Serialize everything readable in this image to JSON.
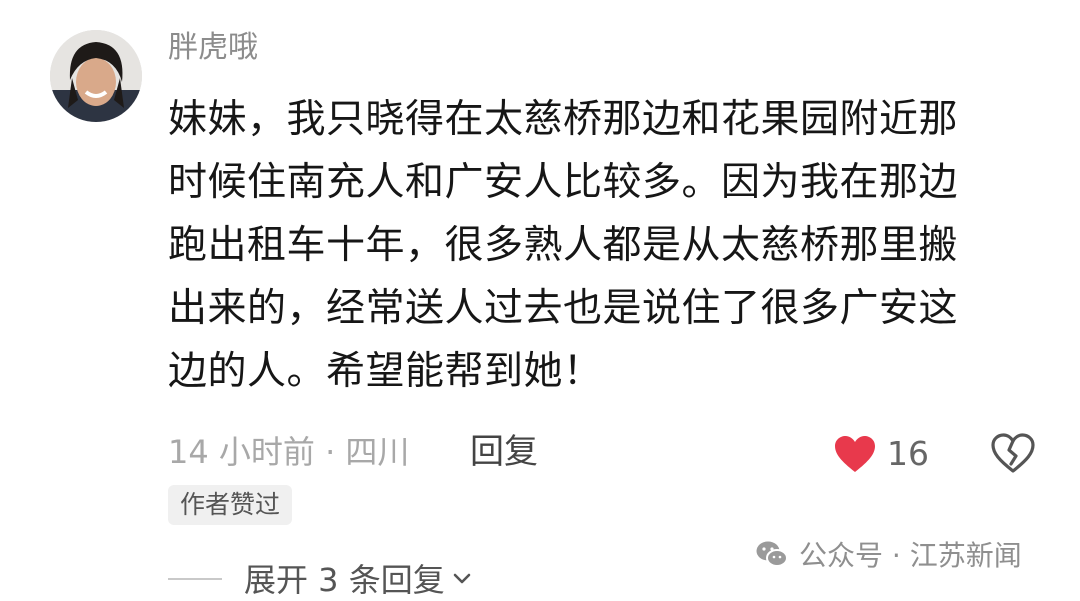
{
  "comment": {
    "username": "胖虎哦",
    "avatar_icon": "user-avatar",
    "body_lines": [
      "妹妹，我只晓得在太慈桥那边和花果园附近那",
      "时候住南充人和广安人比较多。因为我在那边",
      "跑出租车十年，很多熟人都是从太慈桥那里搬",
      "出来的，经常送人过去也是说住了很多广安这",
      "边的人。希望能帮到她！"
    ],
    "meta": "14 小时前 · 四川",
    "reply_label": "回复",
    "like_icon": "heart-icon",
    "like_count": "16",
    "like_color": "#e8394c",
    "dislike_icon": "broken-heart-icon",
    "author_badge": "作者赞过",
    "expand_label": "展开 3 条回复",
    "expand_icon": "chevron-down-icon"
  },
  "watermark": {
    "icon": "wechat-icon",
    "text": "公众号 · 江苏新闻"
  }
}
